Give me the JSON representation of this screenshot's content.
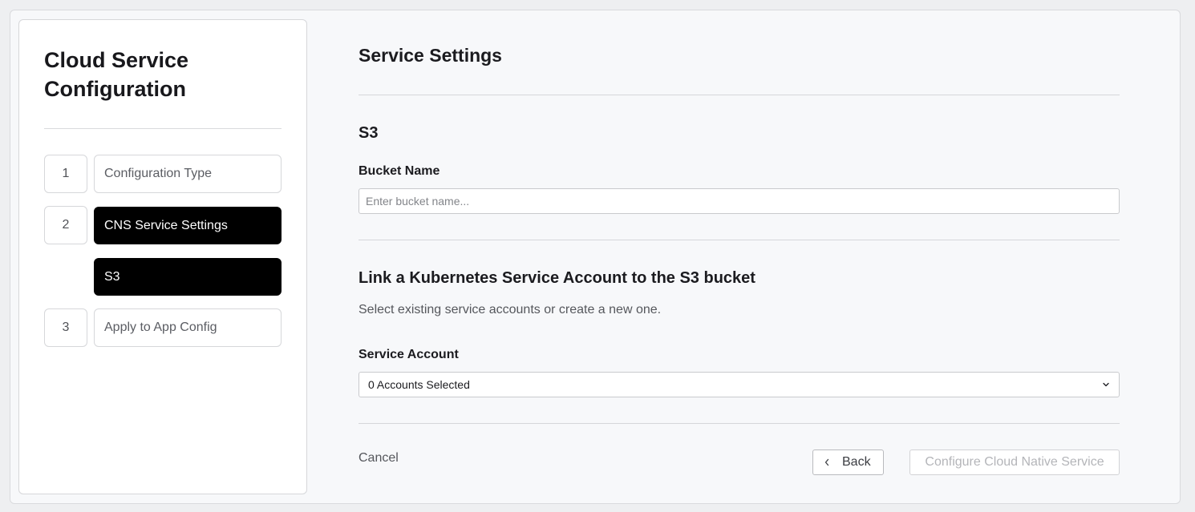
{
  "sidebar": {
    "title": "Cloud Service Configuration",
    "steps": [
      {
        "number": "1",
        "label": "Configuration Type"
      },
      {
        "number": "2",
        "label": "CNS Service Settings"
      },
      {
        "number": "",
        "label": "S3"
      },
      {
        "number": "3",
        "label": "Apply to App Config"
      }
    ]
  },
  "main": {
    "title": "Service Settings",
    "s3_section": {
      "title": "S3",
      "bucket_label": "Bucket Name",
      "bucket_placeholder": "Enter bucket name..."
    },
    "link_section": {
      "title": "Link a Kubernetes Service Account to the S3 bucket",
      "helper": "Select existing service accounts or create a new one.",
      "account_label": "Service Account",
      "account_value": "0 Accounts Selected"
    },
    "footer": {
      "cancel_label": "Cancel",
      "back_label": "Back",
      "configure_label": "Configure Cloud Native Service"
    }
  },
  "icons": {
    "back": "chevron-left-icon",
    "dropdown": "chevron-down-icon"
  },
  "colors": {
    "active_step_bg": "#000000",
    "page_bg": "#f7f8fa",
    "disabled_text": "#b4b5b9"
  }
}
